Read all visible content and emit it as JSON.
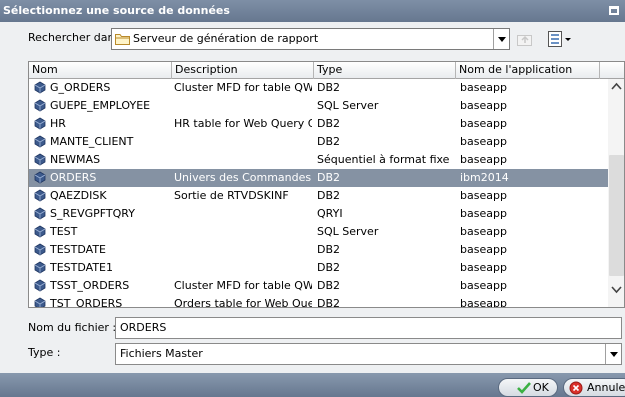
{
  "dialog": {
    "title": "Sélectionnez une source de données"
  },
  "lookin": {
    "label": "Rechercher dans :",
    "value": "Serveur de génération de rapport",
    "icon": "folder-icon"
  },
  "list": {
    "columns": [
      "Nom",
      "Description",
      "Type",
      "Nom de l'application"
    ],
    "rows": [
      {
        "name": "G_ORDERS",
        "description": "Cluster MFD for table QWQCEI",
        "type": "DB2",
        "app": "baseapp"
      },
      {
        "name": "GUEPE_EMPLOYEE",
        "description": "",
        "type": "SQL Server",
        "app": "baseapp"
      },
      {
        "name": "HR",
        "description": "HR table for Web Query QWQ",
        "type": "DB2",
        "app": "baseapp"
      },
      {
        "name": "MANTE_CLIENT",
        "description": "",
        "type": "DB2",
        "app": "baseapp"
      },
      {
        "name": "NEWMAS",
        "description": "",
        "type": "Séquentiel à format fixe",
        "app": "baseapp"
      },
      {
        "name": "ORDERS",
        "description": "Univers des Commandes",
        "type": "DB2",
        "app": "ibm2014",
        "selected": true
      },
      {
        "name": "QAEZDISK",
        "description": "Sortie de RTVDSKINF",
        "type": "DB2",
        "app": "baseapp"
      },
      {
        "name": "S_REVGPFTQRY",
        "description": "",
        "type": "QRYI",
        "app": "baseapp"
      },
      {
        "name": "TEST",
        "description": "",
        "type": "SQL Server",
        "app": "baseapp"
      },
      {
        "name": "TESTDATE",
        "description": "",
        "type": "DB2",
        "app": "baseapp"
      },
      {
        "name": "TESTDATE1",
        "description": "",
        "type": "DB2",
        "app": "baseapp"
      },
      {
        "name": "TSST_ORDERS",
        "description": "Cluster MFD for table QWQCEI",
        "type": "DB2",
        "app": "baseapp"
      },
      {
        "name": "TST_ORDERS",
        "description": "Orders table for Web Query O",
        "type": "DB2",
        "app": "baseapp"
      }
    ]
  },
  "fields": {
    "filename_label": "Nom du fichier :",
    "filename_value": "ORDERS",
    "type_label": "Type :",
    "type_value": "Fichiers Master"
  },
  "buttons": {
    "ok": "OK",
    "cancel": "Annuler"
  },
  "colors": {
    "titlebar": "#7e8fa6",
    "selection": "#8592a3",
    "ok_check": "#3cb043",
    "cancel_icon": "#d9302a"
  }
}
